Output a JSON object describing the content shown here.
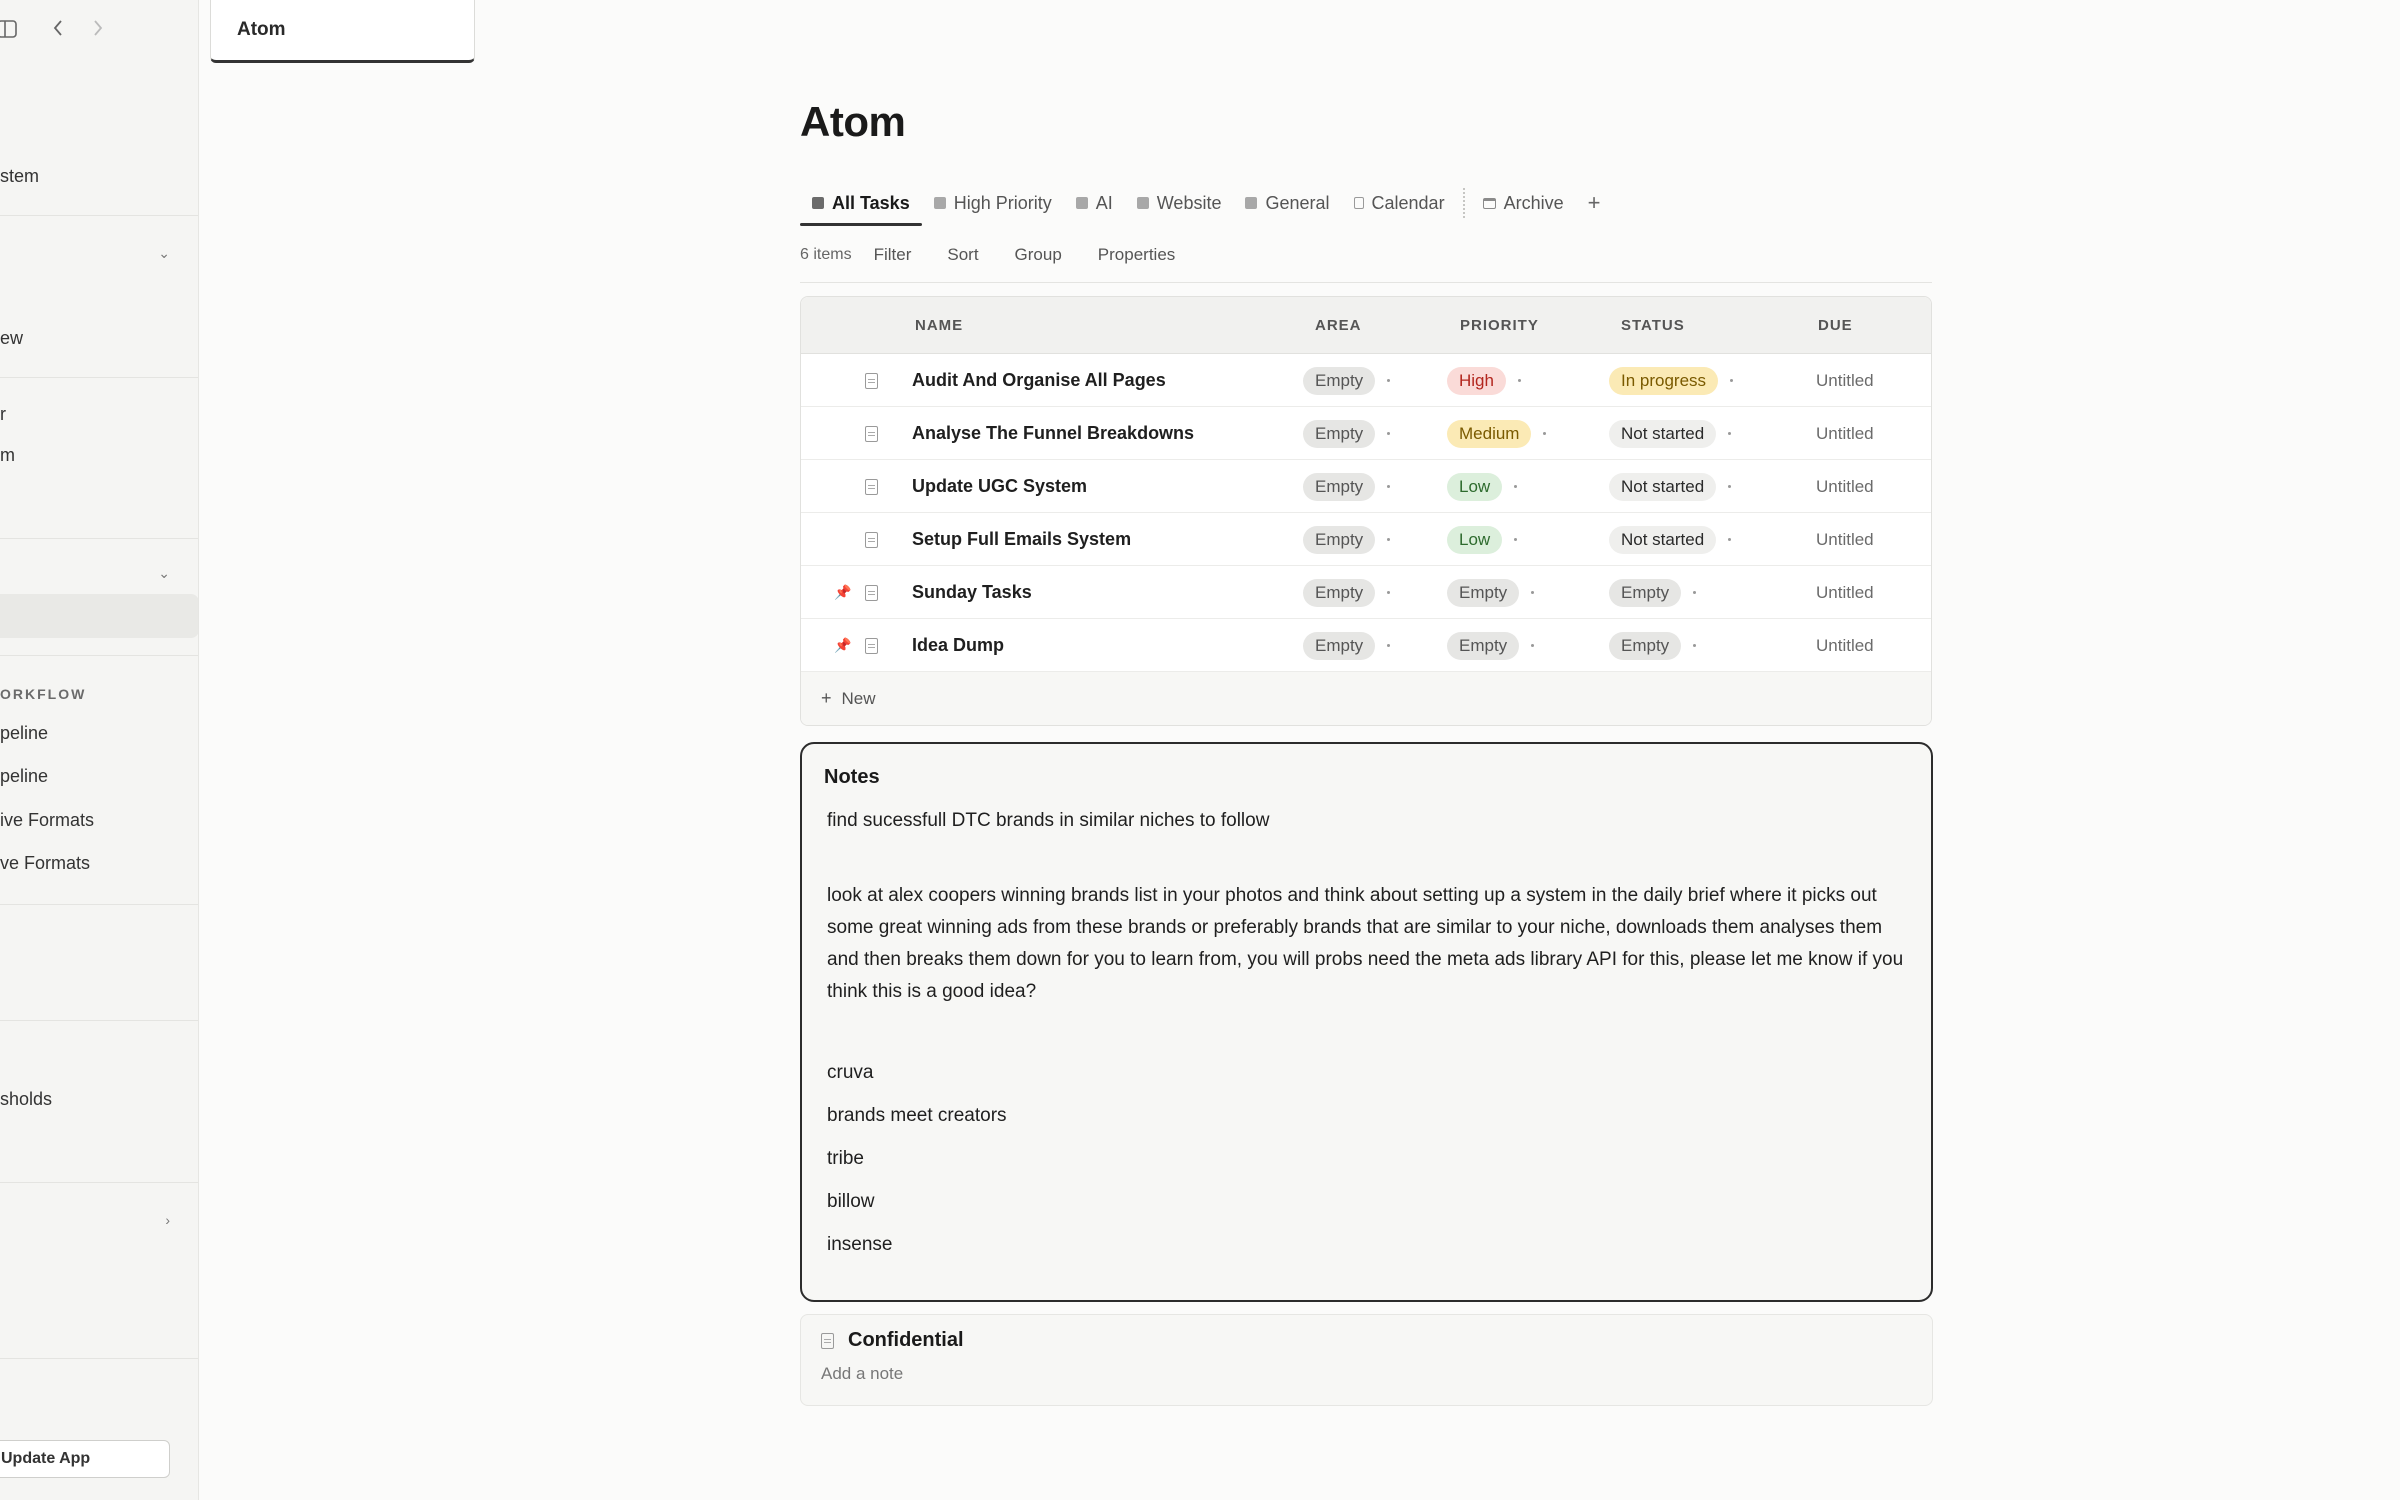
{
  "sidebar": {
    "items": [
      {
        "label": "stem"
      },
      {
        "label": "ew"
      },
      {
        "label": "r"
      },
      {
        "label": "m"
      },
      {
        "label": "peline"
      },
      {
        "label": "peline"
      },
      {
        "label": "ive Formats"
      },
      {
        "label": "ve Formats"
      },
      {
        "label": "sholds"
      }
    ],
    "section_label": "ORKFLOW",
    "update_button": "Update App"
  },
  "tab": {
    "label": "Atom"
  },
  "page": {
    "title": "Atom"
  },
  "views": [
    {
      "label": "All Tasks"
    },
    {
      "label": "High Priority"
    },
    {
      "label": "AI"
    },
    {
      "label": "Website"
    },
    {
      "label": "General"
    },
    {
      "label": "Calendar"
    },
    {
      "label": "Archive"
    }
  ],
  "toolbar": {
    "count": "6 items",
    "filter": "Filter",
    "sort": "Sort",
    "group": "Group",
    "properties": "Properties"
  },
  "table": {
    "columns": {
      "name": "NAME",
      "area": "AREA",
      "priority": "PRIORITY",
      "status": "STATUS",
      "due": "DUE"
    },
    "rows": [
      {
        "name": "Audit And Organise All Pages",
        "area": "Empty",
        "priority": "High",
        "status": "In progress",
        "due": "Untitled"
      },
      {
        "name": "Analyse The Funnel Breakdowns",
        "area": "Empty",
        "priority": "Medium",
        "status": "Not started",
        "due": "Untitled"
      },
      {
        "name": "Update UGC System",
        "area": "Empty",
        "priority": "Low",
        "status": "Not started",
        "due": "Untitled"
      },
      {
        "name": "Setup Full Emails System",
        "area": "Empty",
        "priority": "Low",
        "status": "Not started",
        "due": "Untitled"
      },
      {
        "name": "Sunday Tasks",
        "area": "Empty",
        "priority": "Empty",
        "status": "Empty",
        "due": "Untitled"
      },
      {
        "name": "Idea Dump",
        "area": "Empty",
        "priority": "Empty",
        "status": "Empty",
        "due": "Untitled"
      }
    ],
    "new_label": "New"
  },
  "notes": {
    "title": "Notes",
    "line1": "find sucessfull DTC brands in similar niches to follow",
    "paragraph": "look at alex coopers winning brands list in your photos and think about setting up a system in the daily brief where it picks out some great winning ads from these brands or preferably brands that are similar to your niche, downloads them analyses them and then breaks them down for you to learn from, you will probs need the meta ads library API for this, please let me know if you think this is a good idea?",
    "list": [
      "cruva",
      "brands meet creators",
      "tribe",
      "billow",
      "insense"
    ]
  },
  "confidential": {
    "title": "Confidential",
    "placeholder": "Add a note"
  },
  "colors": {
    "high": "#fadbd8",
    "medium": "#fbeab5",
    "low": "#dcefdc",
    "empty": "#e6e6e4"
  }
}
